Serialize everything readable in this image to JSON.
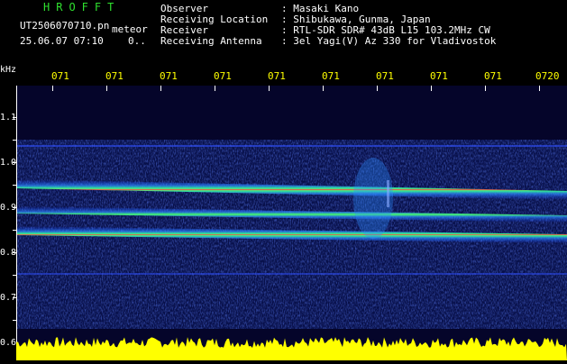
{
  "header": {
    "app_title": "HROFFT",
    "file_name": "UT2506070710.pn",
    "file_suffix": "meteor",
    "timestamp": "25.06.07 07:10",
    "timestamp_extra": "0..",
    "meta": [
      {
        "label": "Observer",
        "value": ": Masaki Kano"
      },
      {
        "label": "Receiving Location",
        "value": ": Shibukawa, Gunma, Japan"
      },
      {
        "label": "Receiver",
        "value": ": RTL-SDR SDR# 43dB L15 103.2MHz CW"
      },
      {
        "label": "Receiving Antenna",
        "value": ": 3el Yagi(V) Az 330 for Vladivostok"
      }
    ]
  },
  "axis": {
    "y_unit": "kHz",
    "y_ticks": [
      "1.1",
      "1.0",
      "0.9",
      "0.8",
      "0.7",
      "0.6"
    ],
    "x_ticks": [
      "071",
      "071",
      "071",
      "071",
      "071",
      "071",
      "071",
      "071",
      "071",
      "0720"
    ]
  },
  "colors": {
    "background": "#05052a",
    "title": "#2fe02f",
    "tick_labels": "#ffff00",
    "signal_strip": "#ffff00"
  }
}
